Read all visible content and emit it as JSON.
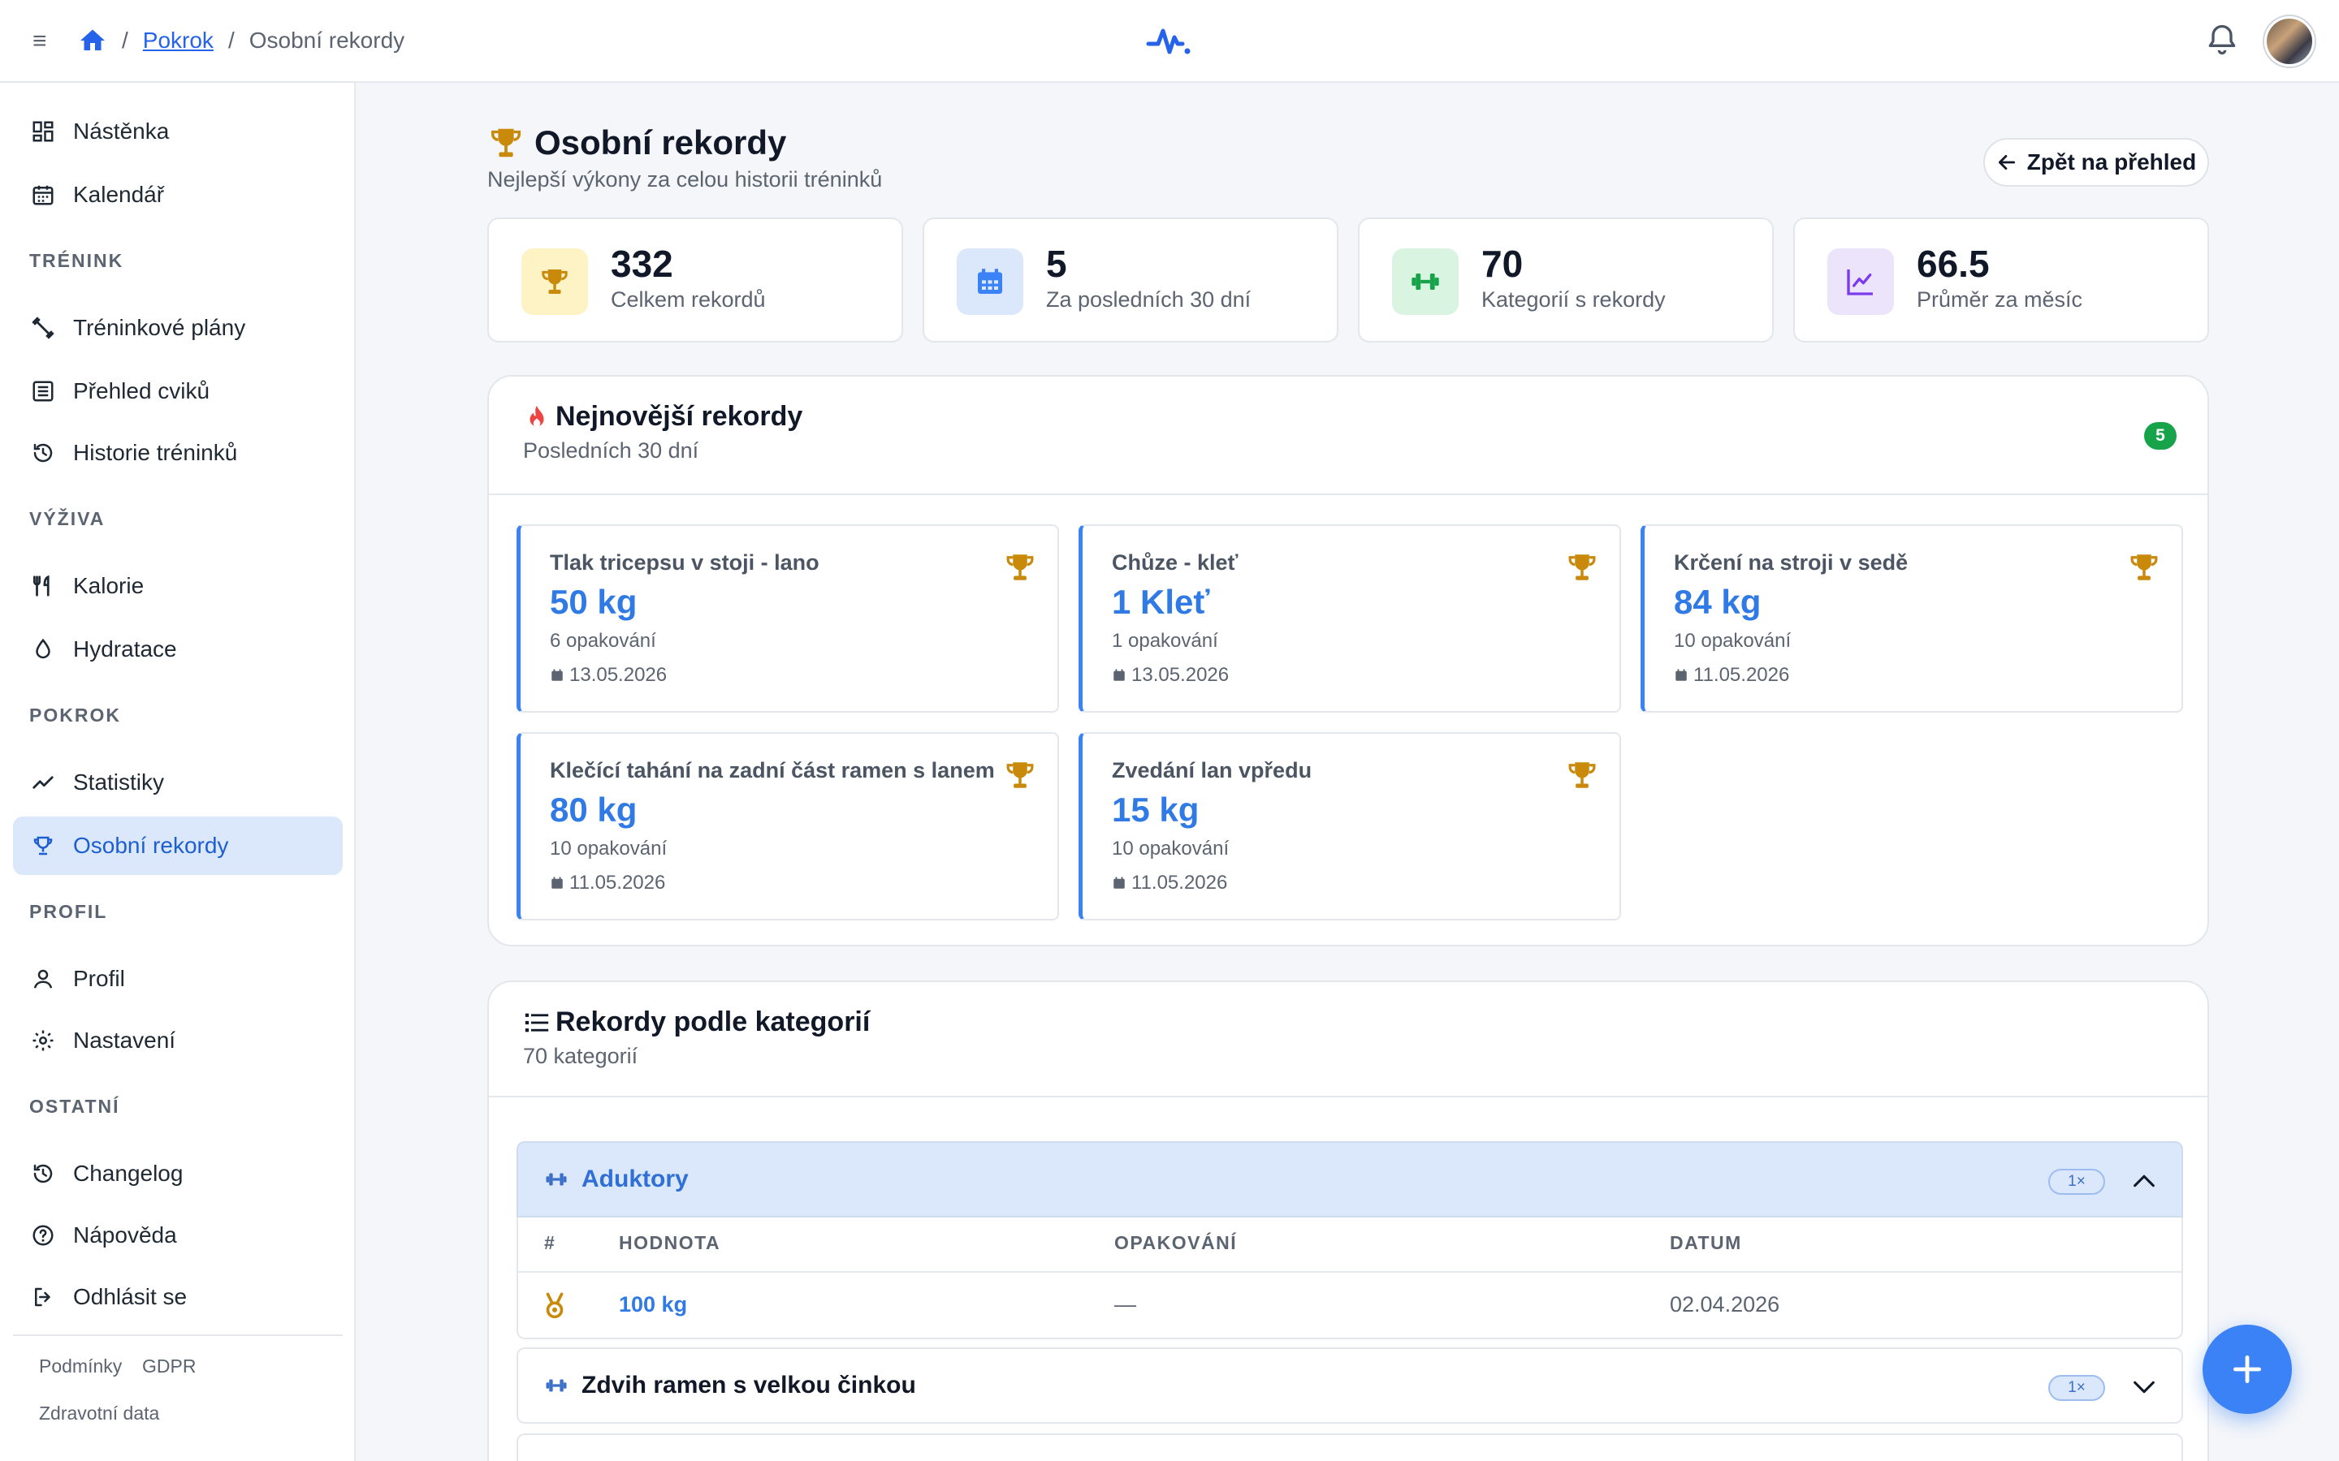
{
  "breadcrumb": {
    "parent": "Pokrok",
    "current": "Osobní rekordy"
  },
  "sidebar": {
    "items": {
      "dashboard": "Nástěnka",
      "calendar": "Kalendář",
      "plans": "Tréninkové plány",
      "exercises": "Přehled cviků",
      "history": "Historie tréninků",
      "calories": "Kalorie",
      "hydration": "Hydratace",
      "stats": "Statistiky",
      "records": "Osobní rekordy",
      "profile": "Profil",
      "settings": "Nastavení",
      "changelog": "Changelog",
      "help": "Nápověda",
      "logout": "Odhlásit se"
    },
    "sections": {
      "training": "TRÉNINK",
      "nutrition": "VÝŽIVA",
      "progress": "POKROK",
      "profile": "PROFIL",
      "other": "OSTATNÍ"
    },
    "footer": {
      "terms": "Podmínky",
      "gdpr": "GDPR",
      "health": "Zdravotní data"
    }
  },
  "page": {
    "title": "Osobní rekordy",
    "subtitle": "Nejlepší výkony za celou historii tréninků",
    "back_label": "Zpět na přehled"
  },
  "stats": [
    {
      "value": "332",
      "label": "Celkem rekordů",
      "icon": "trophy-icon",
      "color": "#c98a0b"
    },
    {
      "value": "5",
      "label": "Za posledních 30 dní",
      "icon": "calendar-icon",
      "color": "#3b82f6"
    },
    {
      "value": "70",
      "label": "Kategorií s rekordy",
      "icon": "dumbbell-icon",
      "color": "#16a34a"
    },
    {
      "value": "66.5",
      "label": "Průměr za měsíc",
      "icon": "chart-line-icon",
      "color": "#7c3aed"
    }
  ],
  "recent": {
    "title": "Nejnovější rekordy",
    "subtitle": "Posledních 30 dní",
    "count": "5",
    "items": [
      {
        "name": "Tlak tricepsu v stoji - lano",
        "value": "50 kg",
        "reps": "6 opakování",
        "date": "13.05.2026"
      },
      {
        "name": "Chůze - kleť",
        "value": "1 Kleť",
        "reps": "1 opakování",
        "date": "13.05.2026"
      },
      {
        "name": "Krčení na stroji v sedě",
        "value": "84 kg",
        "reps": "10 opakování",
        "date": "11.05.2026"
      },
      {
        "name": "Klečící tahání na zadní část ramen s lanem",
        "value": "80 kg",
        "reps": "10 opakování",
        "date": "11.05.2026"
      },
      {
        "name": "Zvedání lan vpředu",
        "value": "15 kg",
        "reps": "10 opakování",
        "date": "11.05.2026"
      }
    ]
  },
  "categories": {
    "title": "Rekordy podle kategorií",
    "subtitle": "70 kategorií",
    "table_headers": {
      "rank": "#",
      "value": "HODNOTA",
      "reps": "OPAKOVÁNÍ",
      "date": "DATUM"
    },
    "groups": [
      {
        "name": "Aduktory",
        "count": "1×",
        "expanded": true,
        "rows": [
          {
            "value": "100 kg",
            "reps": "—",
            "date": "02.04.2026"
          }
        ]
      },
      {
        "name": "Zdvih ramen s velkou činkou",
        "count": "1×",
        "expanded": false
      }
    ]
  },
  "colors": {
    "accent": "#3b82f6",
    "active_bg": "#dbe8fb",
    "trophy": "#c98a0b"
  }
}
